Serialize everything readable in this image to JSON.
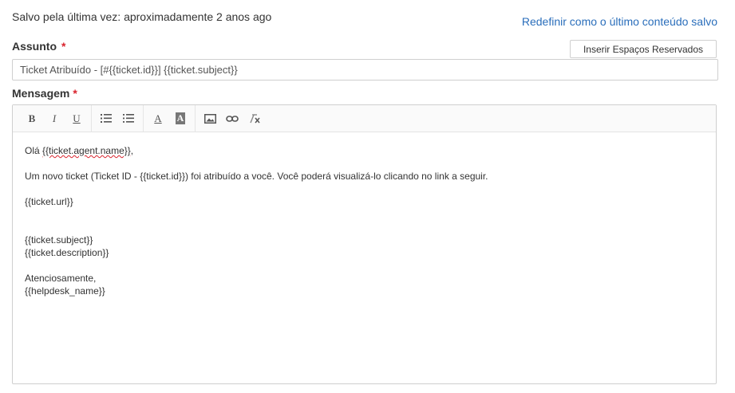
{
  "status": {
    "saved_text": "Salvo pela última vez: aproximadamente 2 anos ago",
    "reset_link": "Redefinir como o último conteúdo salvo"
  },
  "subject": {
    "label": "Assunto",
    "required_mark": "*",
    "value": "Ticket Atribuído - [#{{ticket.id}}] {{ticket.subject}}"
  },
  "placeholders_button": "Inserir Espaços Reservados",
  "message": {
    "label": "Mensagem",
    "required_mark": "*",
    "toolbar": {
      "bold": "B",
      "italic": "I",
      "underline": "U",
      "font_color": "A",
      "bg_color": "A",
      "icons": [
        "bullet-list-icon",
        "numbered-list-icon",
        "image-icon",
        "link-icon",
        "remove-format-icon"
      ]
    },
    "body": {
      "greeting_prefix": "Olá ",
      "greeting_var": "{{ticket.agent.name}}",
      "greeting_suffix": ",",
      "line2": "Um novo ticket (Ticket ID - {{ticket.id}}) foi atribuído a você. Você poderá visualizá-lo clicando no link a seguir.",
      "line3": "{{ticket.url}}",
      "line4": "{{ticket.subject}}",
      "line5": "{{ticket.description}}",
      "line6": "Atenciosamente,",
      "line7": "{{helpdesk_name}}"
    }
  },
  "colors": {
    "link": "#2a6ebb",
    "required": "#d9232d",
    "border": "#cfcfcf"
  }
}
